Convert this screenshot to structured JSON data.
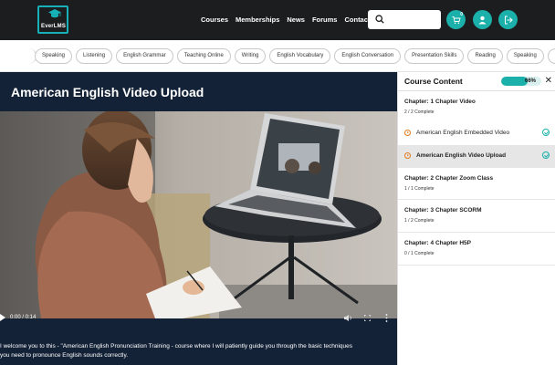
{
  "header": {
    "logo_text": "EverLMS",
    "nav": [
      "Courses",
      "Memberships",
      "News",
      "Forums",
      "Contact Us"
    ],
    "search": {
      "placeholder": ""
    },
    "cart_badge": "0"
  },
  "tags": [
    "Speaking",
    "Listening",
    "English Grammar",
    "Teaching Online",
    "Writing",
    "English Vocabulary",
    "English Conversation",
    "Presentation Skills",
    "Reading",
    "Speaking",
    "Liste"
  ],
  "video": {
    "title": "American English Video Upload",
    "time": "0:00 / 0:14",
    "description": [
      "I welcome you to this - \"American English Pronunciation Training - course where I will patiently guide you through the basic techniques",
      "you need to pronounce English sounds correctly."
    ]
  },
  "sidebar": {
    "title": "Course Content",
    "progress_label": "66%",
    "progress_value": 0.66,
    "chapters": [
      {
        "name": "Chapter: 1 Chapter Video",
        "status": "2 / 2 Complete",
        "lessons": [
          {
            "name": "American English Embedded Video",
            "active": false
          },
          {
            "name": "American English Video Upload",
            "active": true
          }
        ]
      },
      {
        "name": "Chapter: 2 Chapter Zoom Class",
        "status": "1 / 1 Complete"
      },
      {
        "name": "Chapter: 3 Chapter SCORM",
        "status": "1 / 2 Complete"
      },
      {
        "name": "Chapter: 4 Chapter H5P",
        "status": "0 / 1 Complete"
      }
    ]
  },
  "colors": {
    "accent": "#1bb0a9",
    "header_bg": "#1c1d1f",
    "video_panel_bg": "#132237",
    "lesson_icon": "#e07a1f"
  }
}
